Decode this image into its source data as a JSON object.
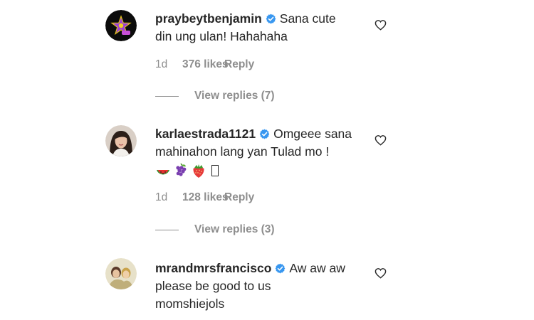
{
  "colors": {
    "text": "#262626",
    "muted": "#8e8e8e",
    "verified": "#3897f0"
  },
  "comments": [
    {
      "username": "praybeytbenjamin",
      "verified": true,
      "text_lines": [
        "Sana cute",
        "din ung ulan! Hahahaha"
      ],
      "time": "1d",
      "likes": "376 likes",
      "reply_label": "Reply",
      "view_replies": "View replies (7)",
      "avatar_icon": "star-logo-avatar"
    },
    {
      "username": "karlaestrada1121",
      "verified": true,
      "text_lines": [
        "Omgeee sana",
        "mahinahon lang yan Tulad mo !"
      ],
      "emojis": [
        "watermelon-emoji",
        "grapes-emoji",
        "strawberry-emoji",
        "missing-glyph"
      ],
      "time": "1d",
      "likes": "128 likes",
      "reply_label": "Reply",
      "view_replies": "View replies (3)",
      "avatar_icon": "woman-portrait-avatar"
    },
    {
      "username": "mrandmrsfrancisco",
      "verified": true,
      "text_lines": [
        "Aw aw aw",
        "please be good to us",
        "momshiejols"
      ],
      "avatar_icon": "couple-portrait-avatar"
    }
  ]
}
